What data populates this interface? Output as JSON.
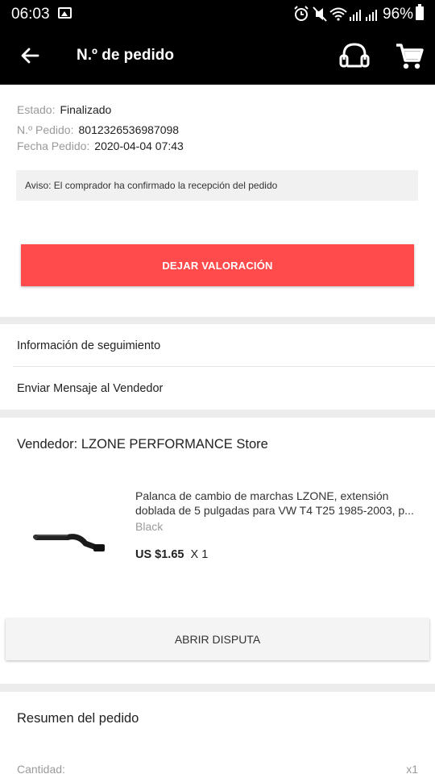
{
  "status_bar": {
    "time": "06:03",
    "battery": "96%",
    "icons": [
      "gallery-icon",
      "alarm-icon",
      "mute-icon",
      "wifi-icon",
      "signal-icon",
      "signal-icon",
      "battery-icon"
    ]
  },
  "header": {
    "title": "N.º de pedido",
    "icons": [
      "back-arrow-icon",
      "headset-support-icon",
      "cart-icon"
    ]
  },
  "order": {
    "status_label": "Estado:",
    "status_value": "Finalizado",
    "number_label": "N.º Pedido:",
    "number_value": "8012326536987098",
    "date_label": "Fecha Pedido:",
    "date_value": "2020-04-04 07:43",
    "notice": "Aviso: El comprador ha confirmado la recepción del pedido",
    "rate_button": "DEJAR VALORACIÓN"
  },
  "links": {
    "tracking": "Información de seguimiento",
    "message_seller": "Enviar Mensaje al Vendedor"
  },
  "seller": {
    "label": "Vendedor:",
    "name": "LZONE PERFORMANCE Store"
  },
  "product": {
    "title_line1": "Palanca de cambio de marchas LZONE, extensión",
    "title_line2": "doblada de 5 pulgadas para VW T4 T25 1985-2003, p...",
    "variant": "Black",
    "price": "US $1.65",
    "quantity": "X 1"
  },
  "dispute_button": "ABRIR DISPUTA",
  "summary": {
    "title": "Resumen del pedido",
    "quantity_label": "Cantidad:",
    "quantity_value": "x1"
  },
  "colors": {
    "accent": "#ff4b4b",
    "header_bg": "#000000",
    "muted_text": "#9a9a9a"
  }
}
